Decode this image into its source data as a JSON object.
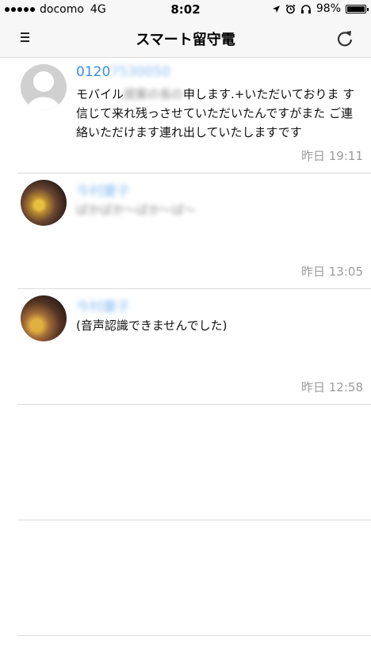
{
  "status": {
    "carrier": "docomo",
    "network": "4G",
    "time": "8:02",
    "battery": "98%",
    "battery_level": 0.98
  },
  "nav": {
    "title": "スマート留守電"
  },
  "messages": [
    {
      "name_visible": "0120",
      "name_hidden": "7530050",
      "text_a": "モバイル",
      "text_hidden": "提案の長の",
      "text_b": "申します.+いただいておりま す信じて来れ残っさせていただいたんですがまた ご連絡いただけます連れ出していたしますです",
      "time": "昨日  19:11"
    },
    {
      "name_hidden": "今村慶子",
      "text_hidden": "ぱかぱか〜ぱか〜ぱ〜",
      "time": "昨日  13:05"
    },
    {
      "name_hidden": "今村慶子",
      "text": "(音声認識できませんでした)",
      "time": "昨日  12:58"
    }
  ],
  "colors": {
    "accent": "#3a8ee6",
    "time": "#9b9b9b",
    "bar": "#f7f7f7"
  }
}
